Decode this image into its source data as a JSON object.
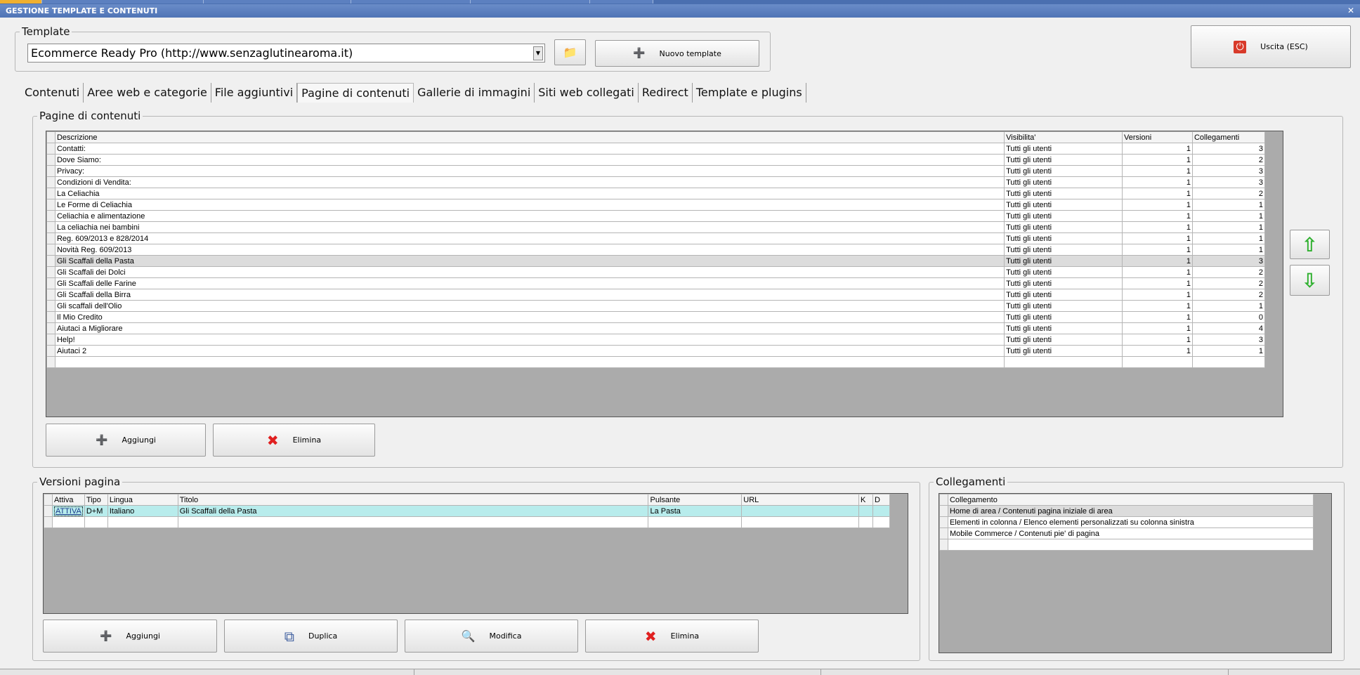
{
  "window": {
    "title": "GESTIONE TEMPLATE E CONTENUTI",
    "close_glyph": "✕"
  },
  "template_group": {
    "legend": "Template",
    "selected": "Ecommerce Ready Pro (http://www.senzaglutinearoma.it)",
    "new_label": "Nuovo template"
  },
  "exit_label": "Uscita (ESC)",
  "tabs": [
    {
      "label": "Contenuti"
    },
    {
      "label": "Aree web e categorie"
    },
    {
      "label": "File aggiuntivi"
    },
    {
      "label": "Pagine di contenuti",
      "active": true
    },
    {
      "label": "Gallerie di immagini"
    },
    {
      "label": "Siti web collegati"
    },
    {
      "label": "Redirect"
    },
    {
      "label": "Template e plugins"
    }
  ],
  "pages": {
    "legend": "Pagine di contenuti",
    "columns": [
      "Descrizione",
      "Visibilita'",
      "Versioni",
      "Collegamenti"
    ],
    "rows": [
      [
        "Contatti:",
        "Tutti gli utenti",
        "1",
        "3"
      ],
      [
        "Dove Siamo:",
        "Tutti gli utenti",
        "1",
        "2"
      ],
      [
        "Privacy:",
        "Tutti gli utenti",
        "1",
        "3"
      ],
      [
        "Condizioni di Vendita:",
        "Tutti gli utenti",
        "1",
        "3"
      ],
      [
        "La Celiachia",
        "Tutti gli utenti",
        "1",
        "2"
      ],
      [
        "Le Forme di Celiachia",
        "Tutti gli utenti",
        "1",
        "1"
      ],
      [
        "Celiachia e alimentazione",
        "Tutti gli utenti",
        "1",
        "1"
      ],
      [
        "La celiachia nei bambini",
        "Tutti gli utenti",
        "1",
        "1"
      ],
      [
        "Reg. 609/2013 e 828/2014",
        "Tutti gli utenti",
        "1",
        "1"
      ],
      [
        "Novità Reg. 609/2013",
        "Tutti gli utenti",
        "1",
        "1"
      ],
      [
        "Gli Scaffali della Pasta",
        "Tutti gli utenti",
        "1",
        "3"
      ],
      [
        "Gli Scaffali dei Dolci",
        "Tutti gli utenti",
        "1",
        "2"
      ],
      [
        "Gli Scaffali delle Farine",
        "Tutti gli utenti",
        "1",
        "2"
      ],
      [
        "Gli Scaffali della Birra",
        "Tutti gli utenti",
        "1",
        "2"
      ],
      [
        "Gli scaffali dell'Olio",
        "Tutti gli utenti",
        "1",
        "1"
      ],
      [
        "Il Mio Credito",
        "Tutti gli utenti",
        "1",
        "0"
      ],
      [
        "Aiutaci a Migliorare",
        "Tutti gli utenti",
        "1",
        "4"
      ],
      [
        "Help!",
        "Tutti gli utenti",
        "1",
        "3"
      ],
      [
        "Aiutaci 2",
        "Tutti gli utenti",
        "1",
        "1"
      ]
    ],
    "selected_row": 10,
    "add_label": "Aggiungi",
    "delete_label": "Elimina"
  },
  "versions": {
    "legend": "Versioni pagina",
    "columns": [
      "Attiva",
      "Tipo",
      "Lingua",
      "Titolo",
      "Pulsante",
      "URL",
      "K",
      "D"
    ],
    "rows": [
      [
        "ATTIVA",
        "D+M",
        "Italiano",
        "Gli Scaffali della Pasta",
        "La Pasta",
        "",
        "",
        ""
      ]
    ],
    "add_label": "Aggiungi",
    "duplicate_label": "Duplica",
    "edit_label": "Modifica",
    "delete_label": "Elimina"
  },
  "links": {
    "legend": "Collegamenti",
    "columns": [
      "Collegamento"
    ],
    "rows": [
      [
        "Home di area / Contenuti pagina iniziale di area"
      ],
      [
        "Elementi in colonna / Elenco elementi personalizzati su colonna sinistra"
      ],
      [
        "Mobile Commerce / Contenuti pie' di pagina"
      ]
    ]
  },
  "icons": {
    "folder": "📁",
    "add": "➕",
    "exit": "⏻",
    "delete": "✖",
    "duplicate": "⧉",
    "edit": "🔍",
    "up": "⇧",
    "down": "⇩",
    "combo_arrow": "▼"
  },
  "colors": {
    "accent_blue": "#4f74b6",
    "selection_cyan": "#b8ecec",
    "arrow_green": "#2fb02f",
    "delete_red": "#e02020"
  }
}
